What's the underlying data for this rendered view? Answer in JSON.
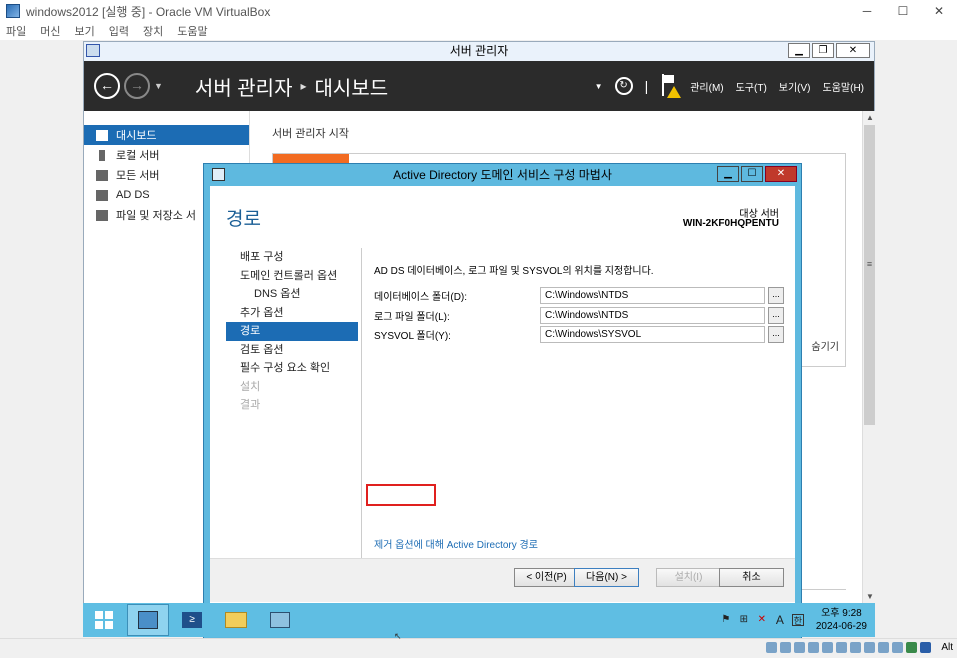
{
  "vbox": {
    "title": "windows2012 [실행 중] - Oracle VM VirtualBox",
    "menu": [
      "파일",
      "머신",
      "보기",
      "입력",
      "장치",
      "도움말"
    ],
    "controls": {
      "minimize": "─",
      "maximize": "☐",
      "close": "✕"
    },
    "host_key": "Alt"
  },
  "server_manager": {
    "title": "서버 관리자",
    "breadcrumb_root": "서버 관리자",
    "breadcrumb_sep": "▸",
    "breadcrumb_page": "대시보드",
    "menu": {
      "manage": "관리(M)",
      "tools": "도구(T)",
      "view": "보기(V)",
      "help": "도움말(H)"
    },
    "sidebar": [
      {
        "label": "대시보드",
        "active": true
      },
      {
        "label": "로컬 서버"
      },
      {
        "label": "모든 서버"
      },
      {
        "label": "AD DS"
      },
      {
        "label": "파일 및 저장소 서"
      }
    ],
    "main_title": "서버 관리자 시작",
    "hide_text": "숨기기"
  },
  "wizard": {
    "title": "Active Directory 도메인 서비스 구성 마법사",
    "heading": "경로",
    "target_label": "대상 서버",
    "target_value": "WIN-2KF0HQPENTU",
    "nav": [
      {
        "label": "배포 구성",
        "state": "normal"
      },
      {
        "label": "도메인 컨트롤러 옵션",
        "state": "normal"
      },
      {
        "label": "DNS 옵션",
        "state": "sub"
      },
      {
        "label": "추가 옵션",
        "state": "normal"
      },
      {
        "label": "경로",
        "state": "active"
      },
      {
        "label": "검토 옵션",
        "state": "normal"
      },
      {
        "label": "필수 구성 요소 확인",
        "state": "normal"
      },
      {
        "label": "설치",
        "state": "disabled"
      },
      {
        "label": "결과",
        "state": "disabled"
      }
    ],
    "description": "AD DS 데이터베이스, 로그 파일 및 SYSVOL의 위치를 지정합니다.",
    "fields": [
      {
        "label": "데이터베이스 폴더(D):",
        "value": "C:\\Windows\\NTDS"
      },
      {
        "label": "로그 파일 폴더(L):",
        "value": "C:\\Windows\\NTDS"
      },
      {
        "label": "SYSVOL 폴더(Y):",
        "value": "C:\\Windows\\SYSVOL"
      }
    ],
    "browse_label": "...",
    "link": "제거 옵션에 대해 Active Directory 경로",
    "buttons": {
      "prev": "< 이전(P)",
      "next": "다음(N) >",
      "install": "설치(I)",
      "cancel": "취소"
    },
    "highlight_color": "#e0201e"
  },
  "taskbar": {
    "ime_lang": "A",
    "ime_mode": "한",
    "time": "오후 9:28",
    "date": "2024-06-29",
    "ps_label": "≥"
  },
  "colors": {
    "accent": "#1c6cb4",
    "wizard_frame": "#5eb9df",
    "dashboard_tile": "#f26b21",
    "header": "#2b2b2b"
  }
}
